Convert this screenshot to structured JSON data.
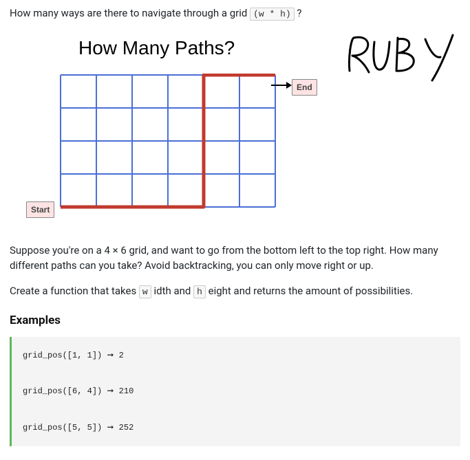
{
  "intro": {
    "prefix": "How many ways are there to navigate through a grid ",
    "code": "(w * h)",
    "suffix": "?"
  },
  "figure": {
    "title": "How Many Paths?",
    "start_label": "Start",
    "end_label": "End",
    "grid": {
      "cols": 6,
      "rows": 4
    }
  },
  "ruby_text": "RUBY",
  "para2": "Suppose you're on a 4 × 6 grid, and want to go from the bottom left to the top right. How many different paths can you take? Avoid backtracking, you can only move right or up.",
  "para3": {
    "prefix": "Create a function that takes ",
    "code1": "w",
    "mid1": "idth and ",
    "code2": "h",
    "mid2": "eight and returns the amount of possibilities."
  },
  "examples_heading": "Examples",
  "examples_code": "grid_pos([1, 1]) ➞ 2\n\ngrid_pos([6, 4]) ➞ 210\n\ngrid_pos([5, 5]) ➞ 252"
}
